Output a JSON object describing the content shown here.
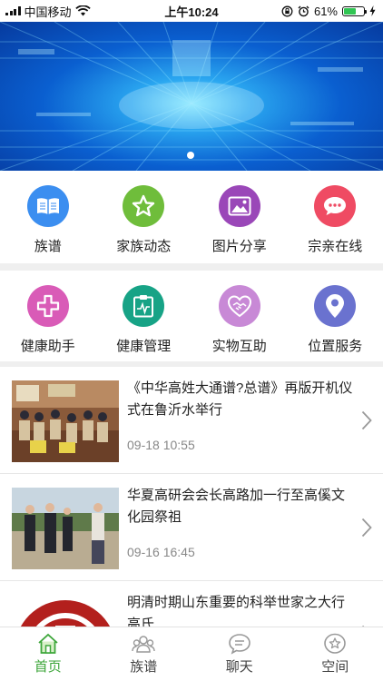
{
  "status_bar": {
    "carrier": "中国移动",
    "time": "上午10:24",
    "battery": "61%"
  },
  "banner": {
    "indicator_count": 1,
    "active_index": 0
  },
  "grid_row1": [
    {
      "label": "族谱",
      "icon": "book-icon",
      "color": "#3b8ef0"
    },
    {
      "label": "家族动态",
      "icon": "star-icon",
      "color": "#6fbd3b"
    },
    {
      "label": "图片分享",
      "icon": "picture-icon",
      "color": "#9a47b8"
    },
    {
      "label": "宗亲在线",
      "icon": "chat-bubble-icon",
      "color": "#ef4b63"
    }
  ],
  "grid_row2": [
    {
      "label": "健康助手",
      "icon": "medical-cross-icon",
      "color": "#d95bb7"
    },
    {
      "label": "健康管理",
      "icon": "clipboard-pulse-icon",
      "color": "#17a386"
    },
    {
      "label": "实物互助",
      "icon": "heart-handshake-icon",
      "color": "#c889d6"
    },
    {
      "label": "位置服务",
      "icon": "location-pin-icon",
      "color": "#6a72cf"
    }
  ],
  "news": [
    {
      "title": "《中华高姓大通谱?总谱》再版开机仪式在鲁沂水举行",
      "time": "09-18 10:55"
    },
    {
      "title": "华夏高研会会长高路加一行至高傒文化园祭祖",
      "time": "09-16 16:45"
    },
    {
      "title": "明清时期山东重要的科举世家之大行高氏",
      "time": ""
    }
  ],
  "tabbar": [
    {
      "label": "首页",
      "icon": "home-icon",
      "active": true
    },
    {
      "label": "族谱",
      "icon": "family-icon",
      "active": false
    },
    {
      "label": "聊天",
      "icon": "chat-icon",
      "active": false
    },
    {
      "label": "空间",
      "icon": "space-star-icon",
      "active": false
    }
  ],
  "colors": {
    "accent": "#3da63a"
  }
}
